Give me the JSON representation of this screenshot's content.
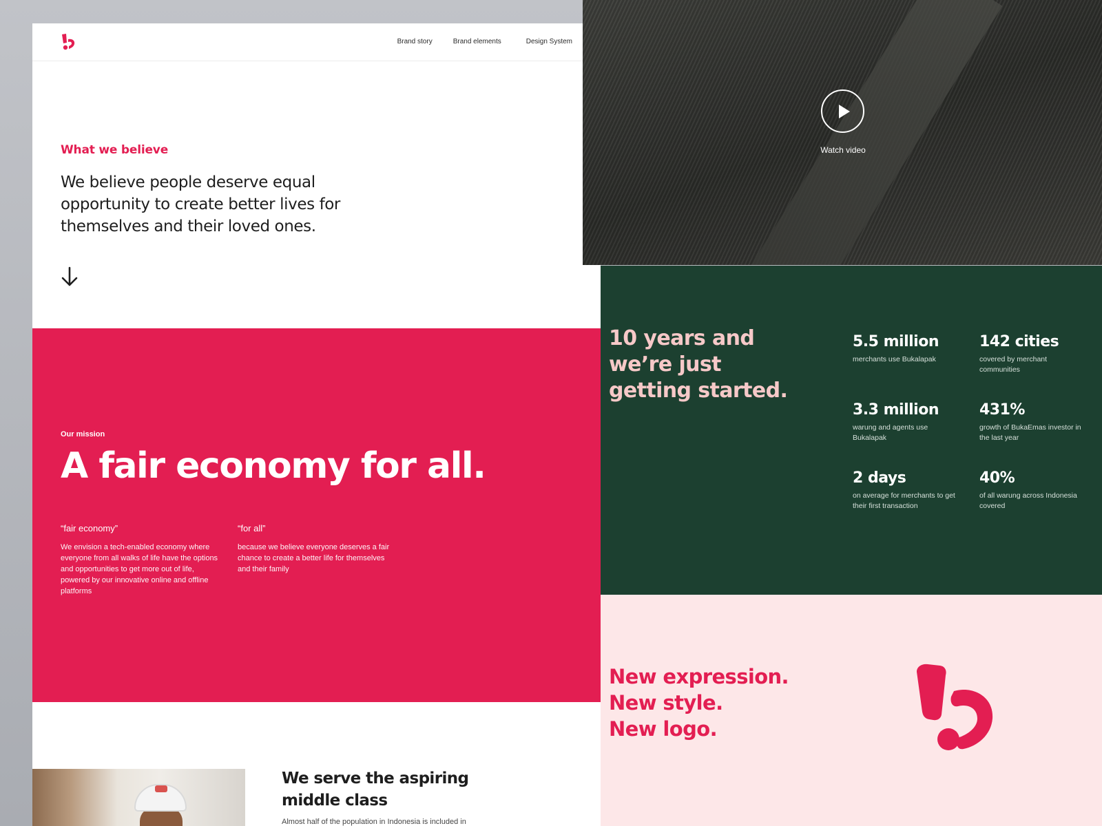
{
  "nav": {
    "links": [
      "Brand story",
      "Brand elements",
      "Design System"
    ]
  },
  "believe": {
    "eyebrow": "What we believe",
    "statement": "We believe people deserve equal opportunity to create better lives for themselves and their loved ones."
  },
  "mission": {
    "label": "Our mission",
    "title": "A fair economy for all.",
    "columns": [
      {
        "heading": "“fair economy”",
        "body": "We envision a tech-enabled  economy where everyone from all walks of life have the options and opportunities to get more out of life, powered by our innovative online and offline platforms"
      },
      {
        "heading": "“for all”",
        "body": "because we believe everyone deserves a fair chance to create a better life for themselves and their family"
      }
    ]
  },
  "serve": {
    "title": "We serve the aspiring middle class",
    "body": "Almost half of the population in Indonesia is included in"
  },
  "video": {
    "label": "Watch video",
    "play_icon": "play-icon"
  },
  "stats": {
    "headline": "10 years and we’re just getting started.",
    "items": [
      {
        "value": "5.5 million",
        "desc": "merchants use Bukalapak"
      },
      {
        "value": "142 cities",
        "desc": "covered by merchant communities"
      },
      {
        "value": "3.3 million",
        "desc": "warung and agents use Bukalapak"
      },
      {
        "value": "431%",
        "desc": "growth of BukaEmas investor in the last year"
      },
      {
        "value": "2 days",
        "desc": "on average for merchants to get their first transaction"
      },
      {
        "value": "40%",
        "desc": "of all warung across Indonesia covered"
      }
    ]
  },
  "new_logo": {
    "lines": [
      "New expression.",
      "New style.",
      "New logo."
    ]
  },
  "colors": {
    "brand_red": "#e31e52",
    "forest_green": "#1c4030",
    "pink_bg": "#fde7e8",
    "headline_pink": "#f6c9c8"
  }
}
